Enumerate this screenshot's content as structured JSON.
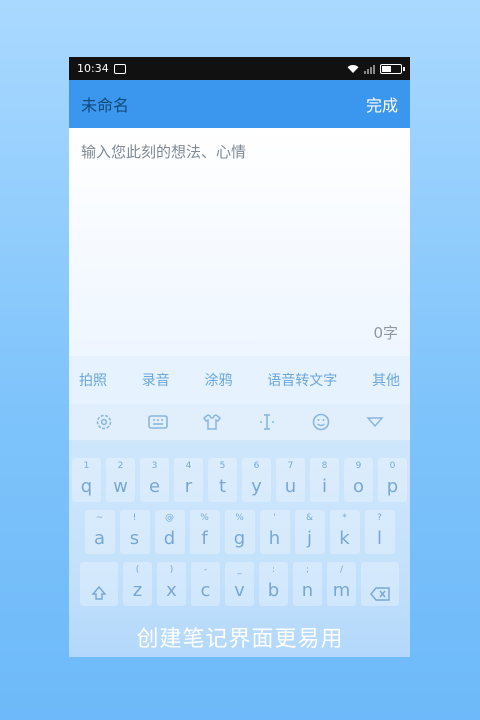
{
  "status": {
    "time": "10:34"
  },
  "note": {
    "title": "未命名",
    "done_label": "完成",
    "placeholder": "输入您此刻的想法、心情",
    "char_count": "0字"
  },
  "tools": {
    "photo": "拍照",
    "record": "录音",
    "doodle": "涂鸦",
    "speech_to_text": "语音转文字",
    "other": "其他"
  },
  "keyboard": {
    "row1": [
      {
        "hint": "1",
        "key": "q"
      },
      {
        "hint": "2",
        "key": "w"
      },
      {
        "hint": "3",
        "key": "e"
      },
      {
        "hint": "4",
        "key": "r"
      },
      {
        "hint": "5",
        "key": "t"
      },
      {
        "hint": "6",
        "key": "y"
      },
      {
        "hint": "7",
        "key": "u"
      },
      {
        "hint": "8",
        "key": "i"
      },
      {
        "hint": "9",
        "key": "o"
      },
      {
        "hint": "0",
        "key": "p"
      }
    ],
    "row2": [
      {
        "hint": "~",
        "key": "a"
      },
      {
        "hint": "!",
        "key": "s"
      },
      {
        "hint": "@",
        "key": "d"
      },
      {
        "hint": "%",
        "key": "f"
      },
      {
        "hint": "%",
        "key": "g"
      },
      {
        "hint": "'",
        "key": "h"
      },
      {
        "hint": "&",
        "key": "j"
      },
      {
        "hint": "*",
        "key": "k"
      },
      {
        "hint": "?",
        "key": "l"
      }
    ],
    "row3": [
      {
        "hint": "(",
        "key": "z"
      },
      {
        "hint": ")",
        "key": "x"
      },
      {
        "hint": "-",
        "key": "c"
      },
      {
        "hint": "_",
        "key": "v"
      },
      {
        "hint": ":",
        "key": "b"
      },
      {
        "hint": ";",
        "key": "n"
      },
      {
        "hint": "/",
        "key": "m"
      }
    ]
  },
  "caption": "创建笔记界面更易用",
  "colors": {
    "accent": "#3b97ee",
    "bg_top": "#aad9ff",
    "bg_bottom": "#6db9f9"
  }
}
